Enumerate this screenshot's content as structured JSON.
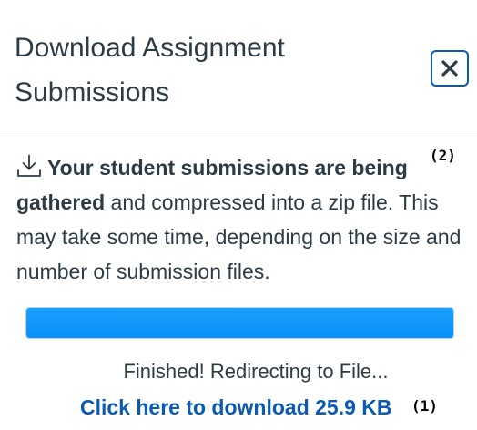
{
  "dialog": {
    "title_line1": "Download Assignment",
    "title_line2": "Submissions",
    "close_icon": "close-x-icon",
    "accent_color": "#0b5ab4"
  },
  "message": {
    "icon": "download-icon",
    "bold_text": "Your student submissions are being gathered",
    "rest_text": " and compressed into a zip file. This may take some time, depending on the size and number of submission files."
  },
  "progress": {
    "value_percent": 100,
    "bar_color": "#0991f8"
  },
  "status": {
    "text": "Finished! Redirecting to File..."
  },
  "download_link": {
    "label": "Click here to download 25.9 KB"
  },
  "annotations": {
    "marker_1": "(1)",
    "marker_2": "(2)"
  }
}
